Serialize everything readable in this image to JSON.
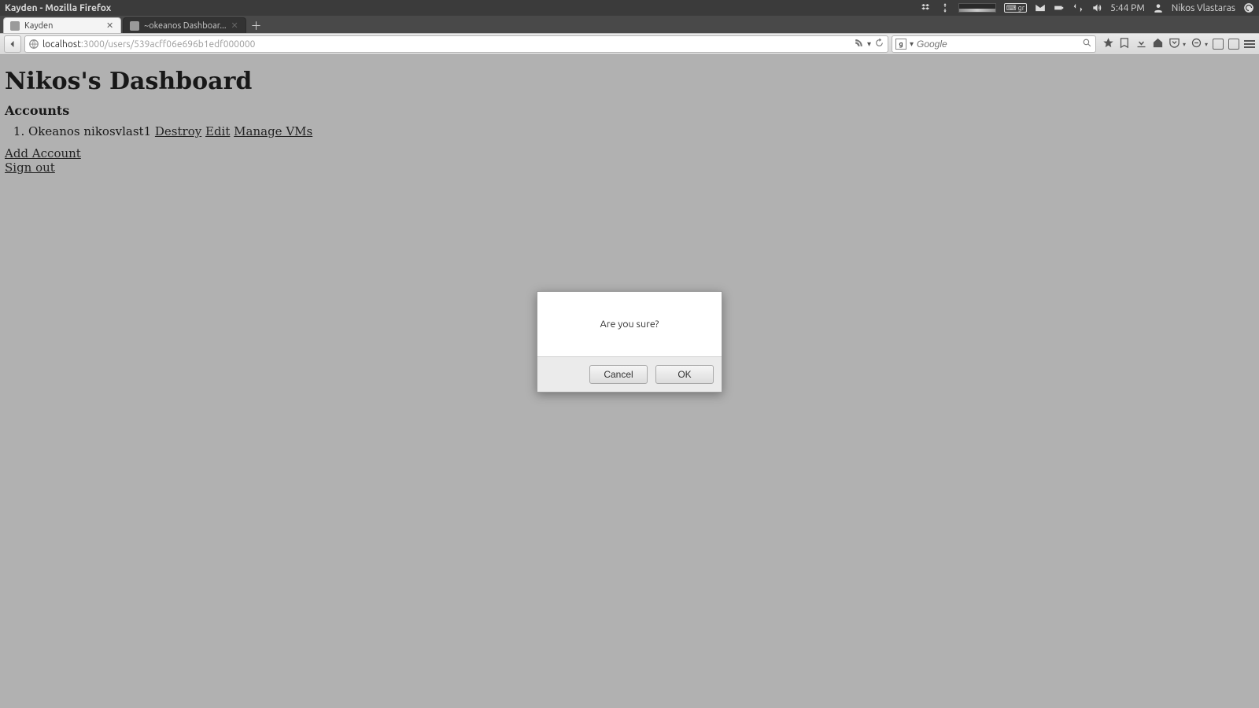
{
  "topbar": {
    "window_title": "Kayden - Mozilla Firefox",
    "keyboard_layout": "gr",
    "clock": "5:44 PM",
    "user": "Nikos Vlastaras"
  },
  "tabs": [
    {
      "label": "Kayden",
      "active": true
    },
    {
      "label": "~okeanos Dashboar...",
      "active": false
    }
  ],
  "urlbar": {
    "host": "localhost",
    "rest": ":3000/users/539acff06e696b1edf000000"
  },
  "search": {
    "placeholder": "Google"
  },
  "page": {
    "title": "Nikos's Dashboard",
    "section": "Accounts",
    "accounts": [
      {
        "label": "Okeanos nikosvlast1",
        "actions": {
          "destroy": "Destroy",
          "edit": "Edit",
          "manage": "Manage VMs"
        }
      }
    ],
    "links": {
      "add_account": "Add Account",
      "sign_out": "Sign out"
    }
  },
  "dialog": {
    "message": "Are you sure?",
    "cancel": "Cancel",
    "ok": "OK"
  }
}
